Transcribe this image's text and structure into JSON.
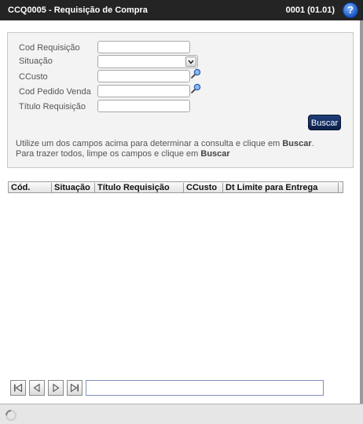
{
  "window": {
    "title": "CCQ0005 - Requisição de Compra",
    "code": "0001 (01.01)",
    "help_symbol": "?"
  },
  "form": {
    "cod_requisicao": {
      "label": "Cod Requisição",
      "value": ""
    },
    "situacao": {
      "label": "Situação",
      "value": ""
    },
    "ccusto": {
      "label": "CCusto",
      "value": ""
    },
    "cod_pedido_venda": {
      "label": "Cod Pedido Venda",
      "value": ""
    },
    "titulo_requisicao": {
      "label": "Título Requisição",
      "value": ""
    },
    "search_button": "Buscar"
  },
  "hint": {
    "line1_prefix": "Utilize um dos campos acima para determinar a consulta e clique em ",
    "line1_bold": "Buscar",
    "line1_suffix": ".",
    "line2_prefix": "Para trazer todos, limpe os campos e clique em ",
    "line2_bold": "Buscar"
  },
  "grid": {
    "columns": [
      "Cód.",
      "Situação",
      "Título Requisição",
      "CCusto",
      "Dt Limite para Entrega"
    ],
    "rows": []
  },
  "pager": {
    "info": ""
  },
  "icons": {
    "help": "help-icon",
    "lookup": "magnifier-icon",
    "dropdown": "chevron-down-icon",
    "first": "first-page-icon",
    "prev": "previous-page-icon",
    "next": "next-page-icon",
    "last": "last-page-icon",
    "loading": "loading-spinner-icon"
  },
  "colors": {
    "titlebar": "#242424",
    "button": "#0b1f4a",
    "panel": "#f3f3f3"
  }
}
